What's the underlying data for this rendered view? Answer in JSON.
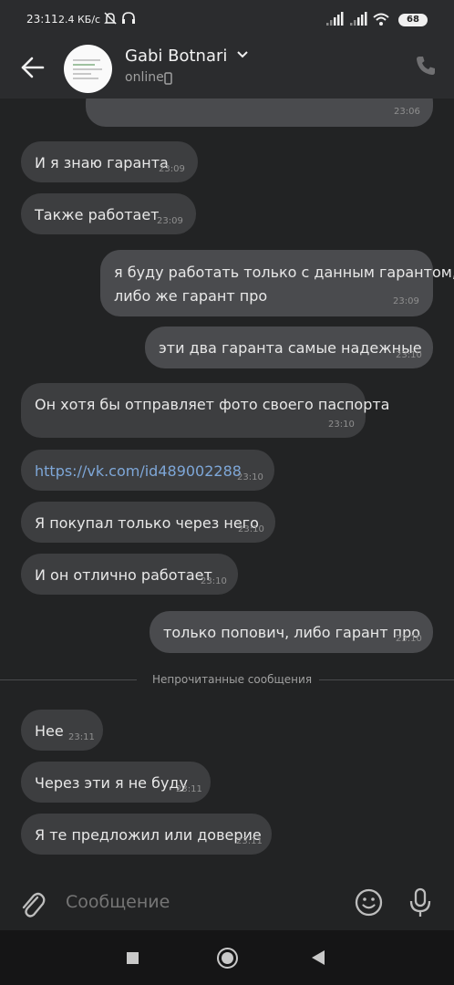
{
  "status_bar": {
    "time": "23:11",
    "net_speed": "2.4 КБ/с",
    "battery": "68"
  },
  "header": {
    "contact_name": "Gabi Botnari",
    "status": "online"
  },
  "messages": [
    {
      "direction": "out",
      "text": "",
      "time": "23:06"
    },
    {
      "direction": "in",
      "text": "И я знаю гаранта",
      "time": "23:09"
    },
    {
      "direction": "in",
      "text": "Также работает",
      "time": "23:09"
    },
    {
      "direction": "out",
      "lines": [
        "я буду работать только с данным гарантом,",
        "либо же гарант про"
      ],
      "time": "23:09"
    },
    {
      "direction": "out",
      "text": "эти два гаранта самые надежные",
      "time": "23:10"
    },
    {
      "direction": "in",
      "text": "Он хотя бы отправляет фото своего паспорта",
      "time": "23:10"
    },
    {
      "direction": "in",
      "text": "https://vk.com/id489002288",
      "time": "23:10",
      "is_link": true
    },
    {
      "direction": "in",
      "text": "Я покупал только через него",
      "time": "23:10"
    },
    {
      "direction": "in",
      "text": "И он отлично работает",
      "time": "23:10"
    },
    {
      "direction": "out",
      "text": "только попович, либо гарант про",
      "time": "23:10"
    },
    {
      "direction": "in",
      "text": "Нее",
      "time": "23:11"
    },
    {
      "direction": "in",
      "text": "Через эти я не буду",
      "time": "23:11"
    },
    {
      "direction": "in",
      "text": "Я те предложил или доверие",
      "time": "23:11"
    }
  ],
  "unread_divider": "Непрочитанные сообщения",
  "composer": {
    "placeholder": "Сообщение"
  },
  "colors": {
    "background": "#222324",
    "incoming_bubble": "#3d3e40",
    "outgoing_bubble": "#4a4b4e",
    "link": "#7ea7d8"
  },
  "icons": [
    "back-arrow-icon",
    "chevron-down-icon",
    "phone-icon",
    "attach-icon",
    "emoji-icon",
    "mic-icon",
    "mute-icon",
    "headphones-icon",
    "signal-icon",
    "wifi-icon",
    "battery-icon",
    "mobile-device-icon"
  ]
}
